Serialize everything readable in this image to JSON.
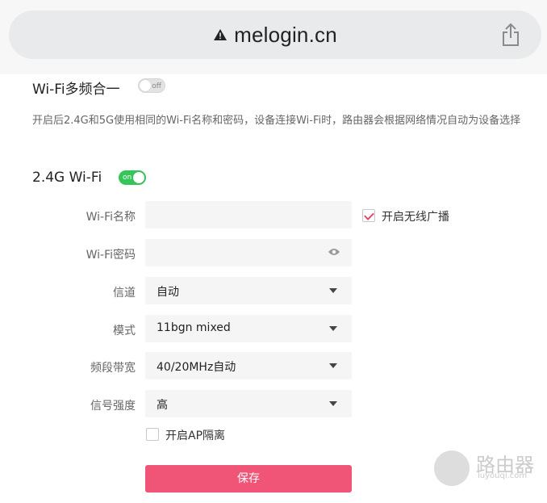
{
  "browser": {
    "url": "melogin.cn",
    "security_icon": "warning-triangle-icon",
    "share_icon": "share-icon"
  },
  "multiband": {
    "title": "Wi-Fi多频合一",
    "toggle_label": "off",
    "enabled": false,
    "description": "开启后2.4G和5G使用相同的Wi-Fi名称和密码，设备连接Wi-Fi时，路由器会根据网络情况自动为设备选择"
  },
  "wifi24": {
    "title": "2.4G Wi-Fi",
    "toggle_label": "on",
    "enabled": true,
    "ssid_label": "Wi-Fi名称",
    "ssid_value": "",
    "broadcast_label": "开启无线广播",
    "broadcast_checked": true,
    "password_label": "Wi-Fi密码",
    "password_value": "",
    "channel_label": "信道",
    "channel_value": "自动",
    "mode_label": "模式",
    "mode_value": "11bgn mixed",
    "bandwidth_label": "频段带宽",
    "bandwidth_value": "40/20MHz自动",
    "power_label": "信号强度",
    "power_value": "高",
    "ap_isolation_label": "开启AP隔离",
    "ap_isolation_checked": false,
    "save_label": "保存"
  },
  "watermark": {
    "text": "路由器",
    "subtext": "luyouqi.com"
  },
  "colors": {
    "accent": "#f05578",
    "toggle_on": "#35c659",
    "check": "#e8496b"
  }
}
